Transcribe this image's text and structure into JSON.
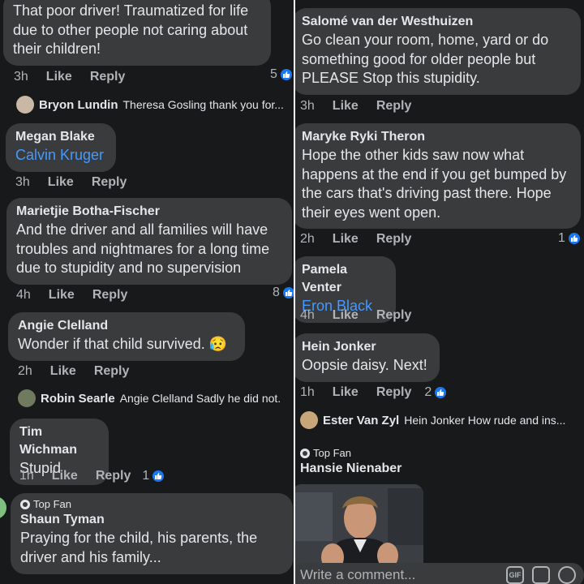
{
  "colors": {
    "background": "#18191a",
    "bubble": "#3a3b3c",
    "mention": "#4599ff",
    "like_badge": "#1877f2"
  },
  "left": {
    "c1": {
      "lines": [
        "That poor driver! Traumatized for life",
        "due to other people not caring about",
        "their children!"
      ],
      "time": "3h",
      "like": "Like",
      "reply": "Reply",
      "likes": "5"
    },
    "r1": {
      "name": "Bryon Lundin",
      "text": "Theresa Gosling thank you for..."
    },
    "c2": {
      "name": "Megan Blake",
      "mention": "Calvin Kruger",
      "time": "3h",
      "like": "Like",
      "reply": "Reply"
    },
    "c3": {
      "name": "Marietjie Botha-Fischer",
      "lines": [
        "And the driver and all  families will have",
        "troubles and nightmares for a long time",
        "due to stupidity and no supervision"
      ],
      "time": "4h",
      "like": "Like",
      "reply": "Reply",
      "likes": "8"
    },
    "c4": {
      "name": "Angie Clelland",
      "text": "Wonder if that child survived. 😥",
      "time": "2h",
      "like": "Like",
      "reply": "Reply"
    },
    "r2": {
      "name": "Robin Searle",
      "text": "Angie Clelland Sadly he did not."
    },
    "c5": {
      "name": "Tim Wichman",
      "text": "Stupid",
      "time": "1h",
      "like": "Like",
      "reply": "Reply",
      "likes": "1"
    },
    "c6": {
      "badge": "Top Fan",
      "name": "Shaun Tyman",
      "lines": [
        "Praying for the child, his parents, the",
        "driver and his family..."
      ]
    }
  },
  "right": {
    "c1": {
      "name": "Salomé van der Westhuizen",
      "lines": [
        "Go clean your room, home, yard or do",
        "something good for older people but",
        "PLEASE Stop this stupidity."
      ],
      "time": "3h",
      "like": "Like",
      "reply": "Reply"
    },
    "c2": {
      "name": "Maryke Ryki Theron",
      "lines": [
        "Hope the other kids saw now what",
        "happens at the end if you get bumped by",
        "the cars that's driving past there. Hope",
        "their eyes went open."
      ],
      "time": "2h",
      "like": "Like",
      "reply": "Reply",
      "likes": "1"
    },
    "c3": {
      "name": "Pamela Venter",
      "mention": "Eron Black",
      "time": "4h",
      "like": "Like",
      "reply": "Reply"
    },
    "c4": {
      "name": "Hein Jonker",
      "text": "Oopsie daisy. Next!",
      "time": "1h",
      "like": "Like",
      "reply": "Reply",
      "likes": "2"
    },
    "r1": {
      "name": "Ester Van Zyl",
      "text": "Hein Jonker How rude and ins..."
    },
    "c5": {
      "badge": "Top Fan",
      "name": "Hansie Nienaber"
    },
    "composer": {
      "placeholder": "Write a comment...",
      "gif_label": "GIF"
    }
  }
}
